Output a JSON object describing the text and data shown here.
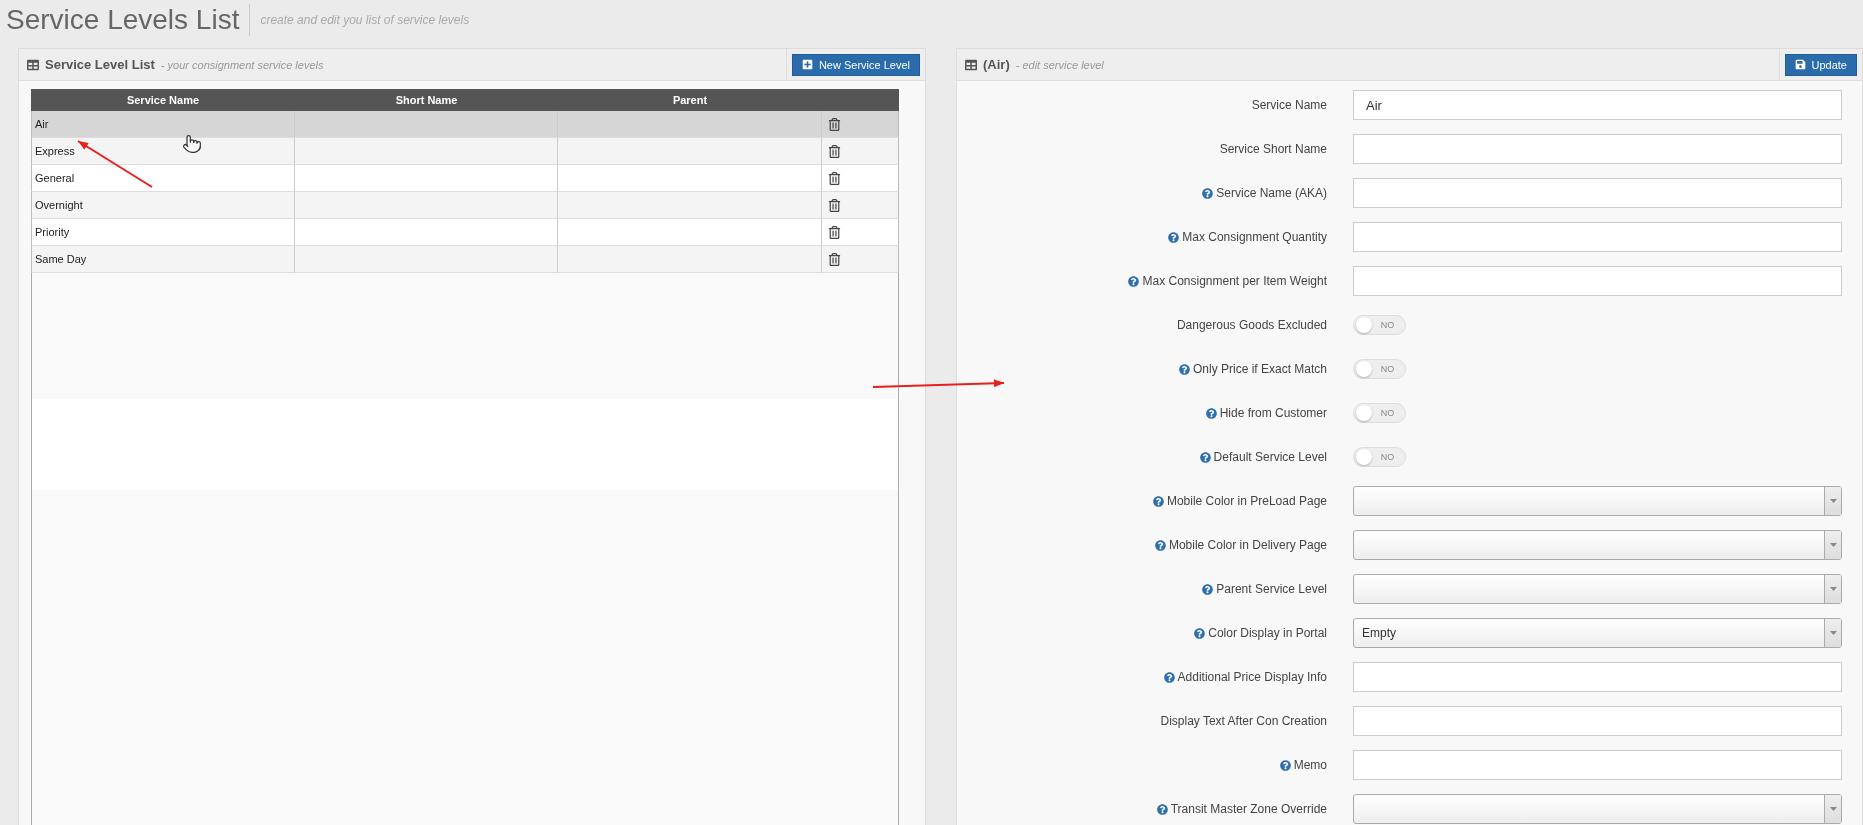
{
  "page": {
    "title": "Service Levels List",
    "subtitle": "create and edit you list of service levels"
  },
  "list_panel": {
    "title": "Service Level List",
    "subtitle": "- your consignment service levels",
    "button": "New Service Level",
    "columns": [
      "Service Name",
      "Short Name",
      "Parent"
    ],
    "rows": [
      {
        "name": "Air",
        "selected": true
      },
      {
        "name": "Express",
        "selected": false
      },
      {
        "name": "General",
        "selected": false
      },
      {
        "name": "Overnight",
        "selected": false
      },
      {
        "name": "Priority",
        "selected": false
      },
      {
        "name": "Same Day",
        "selected": false
      }
    ]
  },
  "edit_panel": {
    "title": "(Air)",
    "subtitle": "- edit service level",
    "button": "Update",
    "fields": [
      {
        "kind": "text",
        "label": "Service Name",
        "help": false,
        "value": "Air"
      },
      {
        "kind": "text",
        "label": "Service Short Name",
        "help": false
      },
      {
        "kind": "text",
        "label": "Service Name (AKA)",
        "help": true
      },
      {
        "kind": "text",
        "label": "Max Consignment Quantity",
        "help": true
      },
      {
        "kind": "text",
        "label": "Max Consignment per Item Weight",
        "help": true
      },
      {
        "kind": "toggle",
        "label": "Dangerous Goods Excluded",
        "help": false,
        "on": false,
        "state_text": "NO"
      },
      {
        "kind": "toggle",
        "label": "Only Price if Exact Match",
        "help": true,
        "on": false,
        "state_text": "NO"
      },
      {
        "kind": "toggle",
        "label": "Hide from Customer",
        "help": true,
        "on": false,
        "state_text": "NO"
      },
      {
        "kind": "toggle",
        "label": "Default Service Level",
        "help": true,
        "on": false,
        "state_text": "NO"
      },
      {
        "kind": "select",
        "label": "Mobile Color in PreLoad Page",
        "help": true
      },
      {
        "kind": "select",
        "label": "Mobile Color in Delivery Page",
        "help": true
      },
      {
        "kind": "select",
        "label": "Parent Service Level",
        "help": true
      },
      {
        "kind": "select",
        "label": "Color Display in Portal",
        "help": true,
        "value": "Empty"
      },
      {
        "kind": "text",
        "label": "Additional Price Display Info",
        "help": true
      },
      {
        "kind": "text",
        "label": "Display Text After Con Creation",
        "help": false
      },
      {
        "kind": "text",
        "label": "Memo",
        "help": true
      },
      {
        "kind": "select",
        "label": "Transit Master Zone Override",
        "help": true
      }
    ]
  }
}
